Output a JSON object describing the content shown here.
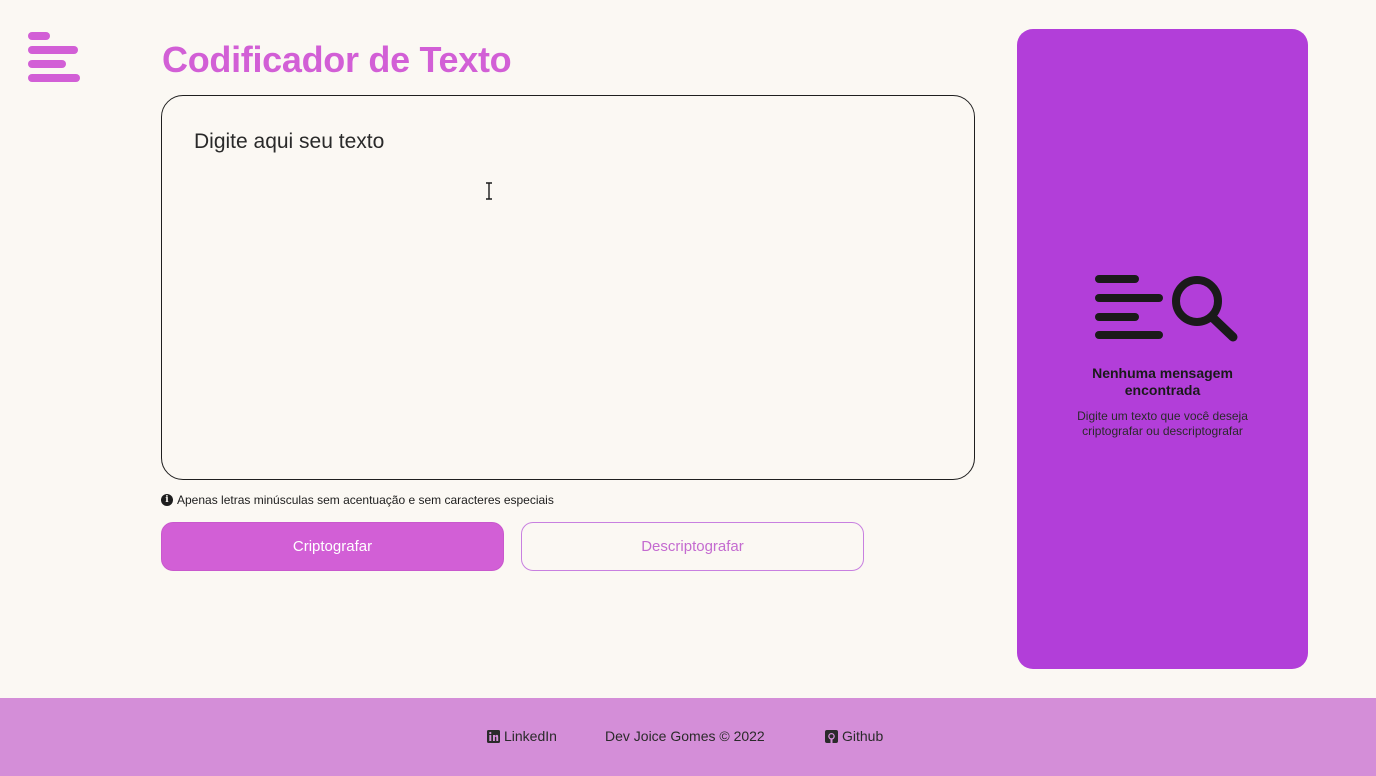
{
  "header": {
    "logo_icon": "menu-lines-icon",
    "title": "Codificador de Texto"
  },
  "editor": {
    "placeholder": "Digite aqui seu texto",
    "value": ""
  },
  "hint": {
    "icon": "info-icon",
    "icon_glyph": "i",
    "text": "Apenas letras minúsculas sem acentuação e sem caracteres especiais"
  },
  "actions": {
    "encrypt_label": "Criptografar",
    "decrypt_label": "Descriptografar"
  },
  "output_panel": {
    "illustration_icon": "search-text-icon",
    "heading": "Nenhuma mensagem encontrada",
    "text": "Digite um texto que você deseja criptografar ou descriptografar"
  },
  "footer": {
    "linkedin_label": "LinkedIn",
    "credit": "Dev Joice Gomes © 2022",
    "github_label": "Github"
  },
  "colors": {
    "background": "#fbf8f3",
    "accent": "#d25fd6",
    "panel": "#b23ed9",
    "footer": "#d48ed8"
  }
}
